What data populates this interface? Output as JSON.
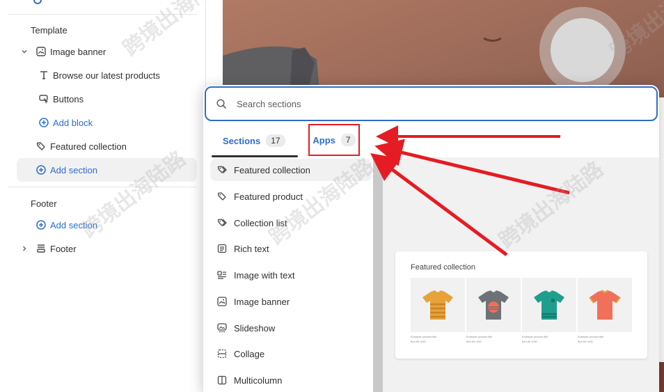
{
  "sidebar": {
    "template_heading": "Template",
    "image_banner": "Image banner",
    "browse_block": "Browse our latest products",
    "buttons_block": "Buttons",
    "add_block": "Add block",
    "featured_collection": "Featured collection",
    "add_section_template": "Add section",
    "footer_heading": "Footer",
    "add_section_footer": "Add section",
    "footer_item": "Footer"
  },
  "popup": {
    "search_placeholder": "Search sections",
    "tabs": {
      "sections_label": "Sections",
      "sections_count": "17",
      "apps_label": "Apps",
      "apps_count": "7"
    },
    "items": [
      {
        "label": "Featured collection",
        "icon": "tag-double-icon"
      },
      {
        "label": "Featured product",
        "icon": "tag-icon"
      },
      {
        "label": "Collection list",
        "icon": "tag-double-icon"
      },
      {
        "label": "Rich text",
        "icon": "text-block-icon"
      },
      {
        "label": "Image with text",
        "icon": "image-text-icon"
      },
      {
        "label": "Image banner",
        "icon": "image-icon"
      },
      {
        "label": "Slideshow",
        "icon": "slideshow-icon"
      },
      {
        "label": "Collage",
        "icon": "collage-icon"
      },
      {
        "label": "Multicolumn",
        "icon": "columns-icon"
      }
    ],
    "preview": {
      "title": "Featured collection",
      "products": [
        {
          "title": "Example product title",
          "price": "$19.99 USD",
          "color": "#e8a23a"
        },
        {
          "title": "Example product title",
          "price": "$19.99 USD",
          "color": "#6e7175"
        },
        {
          "title": "Example product title",
          "price": "$19.99 USD",
          "color": "#1f9e8e"
        },
        {
          "title": "Example product title",
          "price": "$19.99 USD",
          "color": "#f0705a"
        }
      ]
    }
  },
  "watermark": "跨境出海陆路",
  "colors": {
    "accent_blue": "#2c6ecb",
    "highlight_red": "#e51c23"
  }
}
